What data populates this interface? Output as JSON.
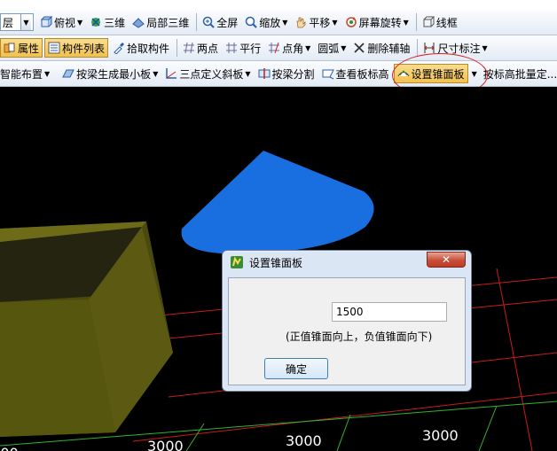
{
  "toolbar1": {
    "layer_combo": "层",
    "top_view": "俯视",
    "view_3d": "三维",
    "partial_3d": "局部三维",
    "fullscreen": "全屏",
    "zoom": "缩放",
    "pan": "平移",
    "screen_rotate": "屏幕旋转",
    "wireframe": "线框"
  },
  "toolbar2": {
    "properties": "属性",
    "component_list": "构件列表",
    "pick_component": "拾取构件",
    "two_points": "两点",
    "parallel": "平行",
    "point_angle": "点角",
    "arc": "圆弧",
    "delete_aux_axis": "删除辅轴",
    "dimension": "尺寸标注"
  },
  "toolbar3": {
    "smart_layout": "智能布置",
    "gen_min_slab_by_beam": "按梁生成最小板",
    "three_point_slope": "三点定义斜板",
    "split_by_beam": "按梁分割",
    "view_slab_elevation": "查看板标高",
    "set_cone_surface": "设置锥面板",
    "batch_by_elevation": "按标高批量定..."
  },
  "viewport": {
    "dim_labels": [
      "3000",
      "3000",
      "3000",
      "3000"
    ]
  },
  "dialog": {
    "title": "设置锥面板",
    "close_symbol": "✕",
    "value": "1500",
    "hint": "(正值锥面向上，负值锥面向下)",
    "ok_label": "确定"
  },
  "colors": {
    "blue_slab": "#1a6fe0",
    "olive_box": "#5a5a10",
    "grid_red": "#c81c1c",
    "grid_green": "#2fb52f"
  }
}
